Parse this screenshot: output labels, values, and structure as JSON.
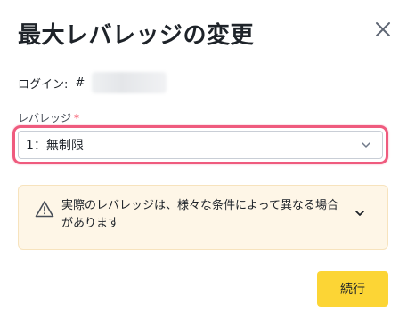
{
  "dialog": {
    "title": "最大レバレッジの変更"
  },
  "login": {
    "label": "ログイン:",
    "hash": "#"
  },
  "leverage": {
    "label": "レバレッジ",
    "required_mark": "*",
    "selected_value": "1：無制限"
  },
  "warning": {
    "text": "実際のレバレッジは、様々な条件によって異なる場合があります"
  },
  "actions": {
    "continue_label": "続行"
  },
  "colors": {
    "accent": "#fcd535",
    "required": "#f6465d",
    "highlight": "#ef5b7e",
    "warning_bg": "#fef6e7"
  },
  "icons": {
    "close": "close-icon",
    "dropdown": "chevron-down-icon",
    "warning": "warning-triangle-icon",
    "expand": "chevron-down-icon"
  }
}
